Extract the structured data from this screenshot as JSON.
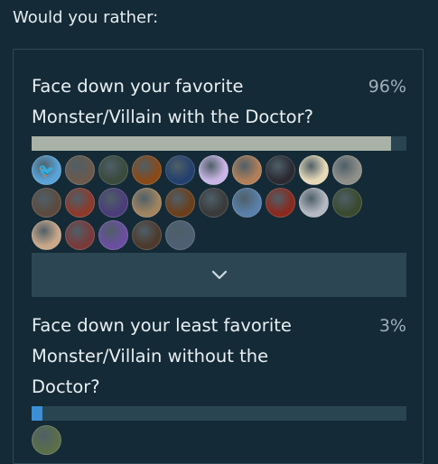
{
  "poll": {
    "prompt": "Would you rather:",
    "expand_icon": "chevron-down-icon",
    "options": [
      {
        "title": "Face down your favorite Monster/Villain with the Doctor?",
        "percent_label": "96%",
        "percent": 96,
        "bar_color": "#a9b2a6",
        "voters": [
          {
            "icon": "bird-avatar",
            "color": "#5aa3d8",
            "glyph": "🐦"
          },
          {
            "icon": "person-avatar",
            "color": "#6b5a4c",
            "glyph": ""
          },
          {
            "icon": "person-avatar",
            "color": "#3a4a3c",
            "glyph": ""
          },
          {
            "icon": "fire-avatar",
            "color": "#8a4a18",
            "glyph": ""
          },
          {
            "icon": "tardis-avatar",
            "color": "#24406e",
            "glyph": ""
          },
          {
            "icon": "ghost-avatar",
            "color": "#c9b6e6",
            "glyph": ""
          },
          {
            "icon": "person-avatar",
            "color": "#b07f5a",
            "glyph": ""
          },
          {
            "icon": "person-avatar",
            "color": "#2b2a33",
            "glyph": ""
          },
          {
            "icon": "duck-avatar",
            "color": "#e7d9b8",
            "glyph": ""
          },
          {
            "icon": "person-avatar",
            "color": "#8f8f8a",
            "glyph": ""
          },
          {
            "icon": "person-avatar",
            "color": "#5c4a3e",
            "glyph": ""
          },
          {
            "icon": "person-avatar",
            "color": "#8c3a2c",
            "glyph": ""
          },
          {
            "icon": "person-avatar",
            "color": "#4b3d78",
            "glyph": ""
          },
          {
            "icon": "person-avatar",
            "color": "#a08460",
            "glyph": ""
          },
          {
            "icon": "person-avatar",
            "color": "#6c3f1c",
            "glyph": ""
          },
          {
            "icon": "skull-avatar",
            "color": "#3a3a3a",
            "glyph": ""
          },
          {
            "icon": "portal-avatar",
            "color": "#5a7fa8",
            "glyph": ""
          },
          {
            "icon": "seal-avatar",
            "color": "#8a2a1e",
            "glyph": ""
          },
          {
            "icon": "person-avatar",
            "color": "#b4b8c2",
            "glyph": ""
          },
          {
            "icon": "person-avatar",
            "color": "#3a4a2e",
            "glyph": ""
          },
          {
            "icon": "person-avatar",
            "color": "#c9a889",
            "glyph": ""
          },
          {
            "icon": "person-avatar",
            "color": "#7a3a3a",
            "glyph": ""
          },
          {
            "icon": "glow-avatar",
            "color": "#6a4fa0",
            "glyph": ""
          },
          {
            "icon": "person-avatar",
            "color": "#4d3a2c",
            "glyph": ""
          },
          {
            "icon": "person-avatar",
            "color": "#4e5f74",
            "glyph": ""
          }
        ]
      },
      {
        "title": "Face down your least favorite Monster/Villain without the Doctor?",
        "percent_label": "3%",
        "percent": 3,
        "bar_color": "#3a8fd6",
        "voters": [
          {
            "icon": "person-avatar",
            "color": "#5b6e4a",
            "glyph": ""
          }
        ]
      }
    ]
  }
}
